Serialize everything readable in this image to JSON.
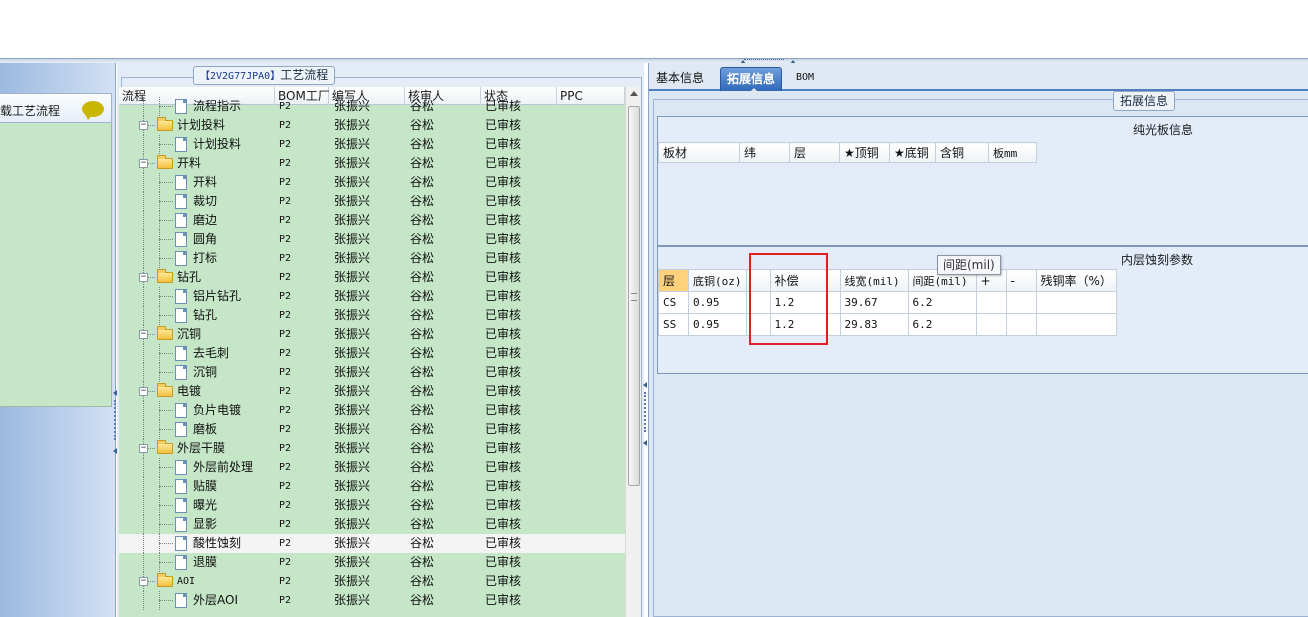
{
  "left_sidebar": {
    "header": "载工艺流程"
  },
  "tree_panel": {
    "title_code": "【2V2G77JPA0】",
    "title_text": "工艺流程",
    "columns": [
      "流程",
      "BOM工厂",
      "编写人",
      "核审人",
      "状态",
      "PPC"
    ],
    "rows": [
      {
        "name": "流程指示",
        "level": 2,
        "factory": "P2",
        "writer": "张振兴",
        "reviewer": "谷松",
        "status": "已审核"
      },
      {
        "name": "计划投料",
        "level": 1,
        "factory": "P2",
        "writer": "张振兴",
        "reviewer": "谷松",
        "status": "已审核"
      },
      {
        "name": "计划投料",
        "level": 2,
        "factory": "P2",
        "writer": "张振兴",
        "reviewer": "谷松",
        "status": "已审核"
      },
      {
        "name": "开料",
        "level": 1,
        "factory": "P2",
        "writer": "张振兴",
        "reviewer": "谷松",
        "status": "已审核"
      },
      {
        "name": "开料",
        "level": 2,
        "factory": "P2",
        "writer": "张振兴",
        "reviewer": "谷松",
        "status": "已审核"
      },
      {
        "name": "裁切",
        "level": 2,
        "factory": "P2",
        "writer": "张振兴",
        "reviewer": "谷松",
        "status": "已审核"
      },
      {
        "name": "磨边",
        "level": 2,
        "factory": "P2",
        "writer": "张振兴",
        "reviewer": "谷松",
        "status": "已审核"
      },
      {
        "name": "圆角",
        "level": 2,
        "factory": "P2",
        "writer": "张振兴",
        "reviewer": "谷松",
        "status": "已审核"
      },
      {
        "name": "打标",
        "level": 2,
        "factory": "P2",
        "writer": "张振兴",
        "reviewer": "谷松",
        "status": "已审核"
      },
      {
        "name": "钻孔",
        "level": 1,
        "factory": "P2",
        "writer": "张振兴",
        "reviewer": "谷松",
        "status": "已审核"
      },
      {
        "name": "铝片钻孔",
        "level": 2,
        "factory": "P2",
        "writer": "张振兴",
        "reviewer": "谷松",
        "status": "已审核"
      },
      {
        "name": "钻孔",
        "level": 2,
        "factory": "P2",
        "writer": "张振兴",
        "reviewer": "谷松",
        "status": "已审核"
      },
      {
        "name": "沉铜",
        "level": 1,
        "factory": "P2",
        "writer": "张振兴",
        "reviewer": "谷松",
        "status": "已审核"
      },
      {
        "name": "去毛刺",
        "level": 2,
        "factory": "P2",
        "writer": "张振兴",
        "reviewer": "谷松",
        "status": "已审核"
      },
      {
        "name": "沉铜",
        "level": 2,
        "factory": "P2",
        "writer": "张振兴",
        "reviewer": "谷松",
        "status": "已审核"
      },
      {
        "name": "电镀",
        "level": 1,
        "factory": "P2",
        "writer": "张振兴",
        "reviewer": "谷松",
        "status": "已审核"
      },
      {
        "name": "负片电镀",
        "level": 2,
        "factory": "P2",
        "writer": "张振兴",
        "reviewer": "谷松",
        "status": "已审核"
      },
      {
        "name": "磨板",
        "level": 2,
        "factory": "P2",
        "writer": "张振兴",
        "reviewer": "谷松",
        "status": "已审核"
      },
      {
        "name": "外层干膜",
        "level": 1,
        "factory": "P2",
        "writer": "张振兴",
        "reviewer": "谷松",
        "status": "已审核"
      },
      {
        "name": "外层前处理",
        "level": 2,
        "factory": "P2",
        "writer": "张振兴",
        "reviewer": "谷松",
        "status": "已审核"
      },
      {
        "name": "贴膜",
        "level": 2,
        "factory": "P2",
        "writer": "张振兴",
        "reviewer": "谷松",
        "status": "已审核"
      },
      {
        "name": "曝光",
        "level": 2,
        "factory": "P2",
        "writer": "张振兴",
        "reviewer": "谷松",
        "status": "已审核"
      },
      {
        "name": "显影",
        "level": 2,
        "factory": "P2",
        "writer": "张振兴",
        "reviewer": "谷松",
        "status": "已审核"
      },
      {
        "name": "酸性蚀刻",
        "level": 2,
        "factory": "P2",
        "writer": "张振兴",
        "reviewer": "谷松",
        "status": "已审核",
        "selected": true
      },
      {
        "name": "退膜",
        "level": 2,
        "factory": "P2",
        "writer": "张振兴",
        "reviewer": "谷松",
        "status": "已审核"
      },
      {
        "name": "AOI",
        "level": 1,
        "factory": "P2",
        "writer": "张振兴",
        "reviewer": "谷松",
        "status": "已审核"
      },
      {
        "name": "外层AOI",
        "level": 2,
        "factory": "P2",
        "writer": "张振兴",
        "reviewer": "谷松",
        "status": "已审核"
      }
    ]
  },
  "right_panel": {
    "tabs": [
      "基本信息",
      "拓展信息",
      "BOM"
    ],
    "active_tab": "拓展信息",
    "section_title": "拓展信息",
    "board_info": {
      "title": "纯光板信息",
      "columns": [
        "板材",
        "纬",
        "层",
        "★顶铜",
        "★底铜",
        "含铜",
        "板mm"
      ]
    },
    "etch_params": {
      "title": "内层蚀刻参数",
      "columns": [
        "层",
        "底铜(oz)",
        "",
        "补偿",
        "线宽(mil)",
        "间距(mil)",
        "+",
        "-",
        "残铜率（%）"
      ],
      "rows": [
        [
          "CS",
          "0.95",
          "",
          "1.2",
          "39.67",
          "6.2",
          "",
          "",
          ""
        ],
        [
          "SS",
          "0.95",
          "",
          "1.2",
          "29.83",
          "6.2",
          "",
          "",
          ""
        ]
      ]
    },
    "tooltip": "间距(mil)"
  },
  "colors": {
    "tree_background": "#c5e6c7",
    "active_tab": "#2e68b8",
    "highlight_box": "#e02020",
    "header_orange": "#ffd17a"
  }
}
